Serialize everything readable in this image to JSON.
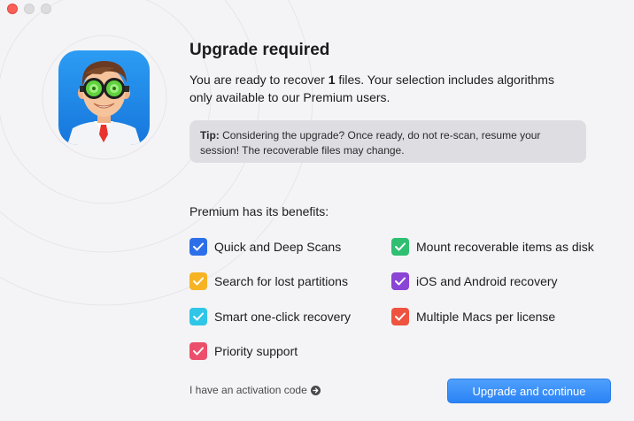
{
  "window": {
    "controls": [
      "close",
      "minimize",
      "maximize"
    ]
  },
  "app_icon": {
    "icon": "doctor-character-app-icon"
  },
  "dialog": {
    "title": "Upgrade required",
    "message_prefix": "You are ready to recover ",
    "file_count": "1",
    "message_suffix": " files. Your selection includes algorithms only available to our Premium users.",
    "tip_label": "Tip:",
    "tip_text": " Considering the upgrade? Once ready, do not re-scan, resume your session! The recoverable files may change.",
    "benefits_heading": "Premium has its benefits:"
  },
  "benefits": [
    {
      "label": "Quick and Deep Scans",
      "color": "#2c6fe8",
      "checked": true
    },
    {
      "label": "Mount recoverable items as disk",
      "color": "#2fbf71",
      "checked": true
    },
    {
      "label": "Search for lost partitions",
      "color": "#f6b425",
      "checked": true
    },
    {
      "label": "iOS and Android recovery",
      "color": "#8b45d6",
      "checked": true
    },
    {
      "label": "Smart one-click recovery",
      "color": "#2fc6e8",
      "checked": true
    },
    {
      "label": "Multiple Macs per license",
      "color": "#ee5340",
      "checked": true
    },
    {
      "label": "Priority support",
      "color": "#ec4f6b",
      "checked": true
    }
  ],
  "footer": {
    "activation_link": "I have an activation code",
    "activation_icon": "arrow-right-circle-icon",
    "upgrade_button": "Upgrade and continue"
  },
  "colors": {
    "accent": "#2b83f6",
    "background": "#f4f4f6",
    "tip_background": "#dedee2"
  }
}
